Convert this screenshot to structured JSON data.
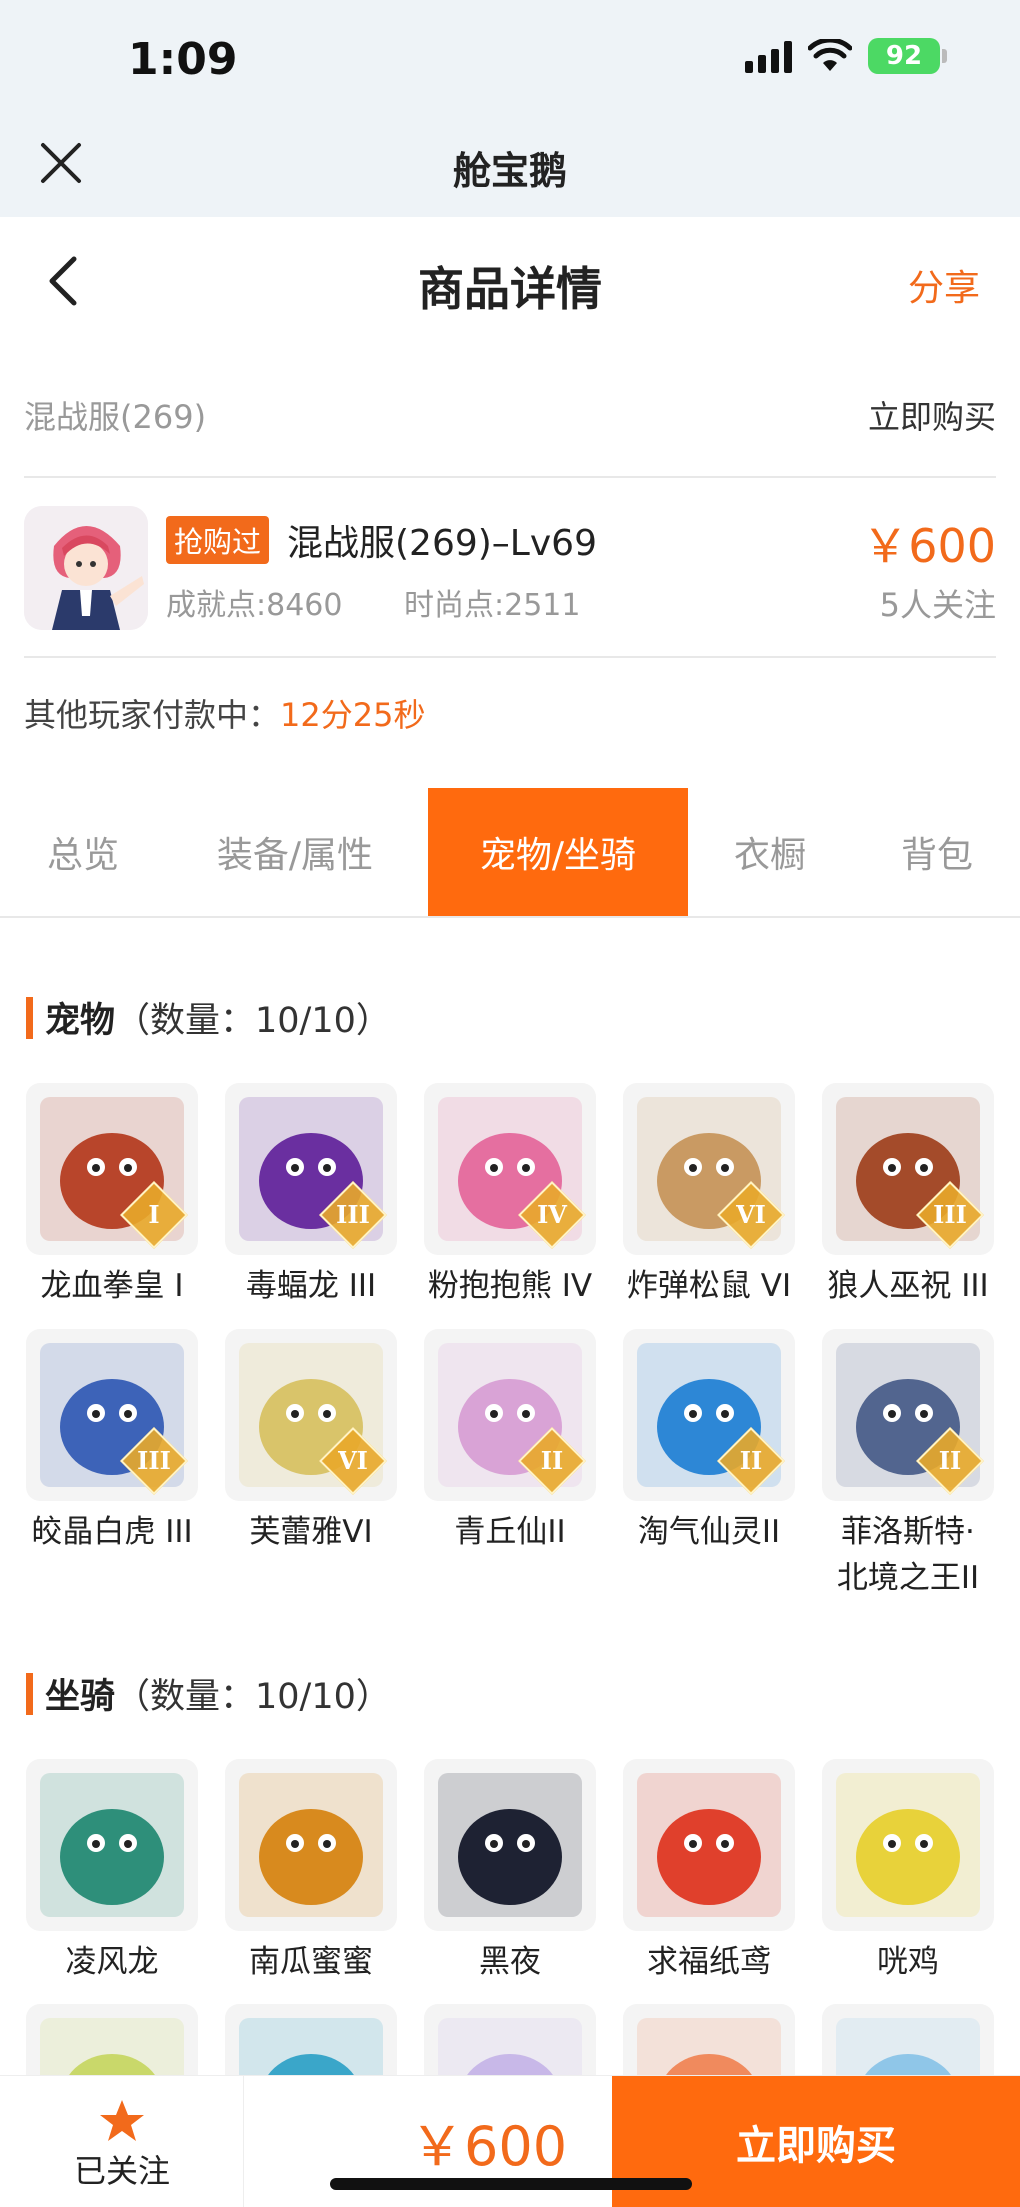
{
  "status_bar": {
    "time": "1:09",
    "battery": "92"
  },
  "app": {
    "title": "舱宝鹅"
  },
  "header": {
    "title": "商品详情",
    "share": "分享"
  },
  "server": {
    "name": "混战服(269)",
    "buy_now": "立即购买"
  },
  "product": {
    "tag": "抢购过",
    "name": "混战服(269)–Lv69",
    "achievement": "成就点:8460",
    "fashion": "时尚点:2511",
    "price": "￥600",
    "followers": "5人关注"
  },
  "paying": {
    "label": "其他玩家付款中：",
    "countdown": "12分25秒"
  },
  "tabs": [
    "总览",
    "装备/属性",
    "宠物/坐骑",
    "衣橱",
    "背包"
  ],
  "active_tab": "宠物/坐骑",
  "pets": {
    "title": "宠物",
    "count": "（数量：10/10）",
    "items": [
      {
        "name": "龙血拳皇 I",
        "rank": "I",
        "icon": "demon-icon",
        "color": "#b8452b"
      },
      {
        "name": "毒蝠龙 III",
        "rank": "III",
        "icon": "bat-dragon-icon",
        "color": "#6a2fa0"
      },
      {
        "name": "粉抱抱熊 IV",
        "rank": "IV",
        "icon": "bear-icon",
        "color": "#e56fa0"
      },
      {
        "name": "炸弹松鼠 VI",
        "rank": "VI",
        "icon": "squirrel-icon",
        "color": "#c99a63"
      },
      {
        "name": "狼人巫祝 III",
        "rank": "III",
        "icon": "werewolf-icon",
        "color": "#a44b2a"
      },
      {
        "name": "皎晶白虎 III",
        "rank": "III",
        "icon": "white-tiger-icon",
        "color": "#3d63b8"
      },
      {
        "name": "芙蕾雅VI",
        "rank": "VI",
        "icon": "fairy-icon",
        "color": "#d9c46a"
      },
      {
        "name": "青丘仙II",
        "rank": "II",
        "icon": "fox-spirit-icon",
        "color": "#d9a3d6"
      },
      {
        "name": "淘气仙灵II",
        "rank": "II",
        "icon": "blue-puppy-icon",
        "color": "#2d87d6"
      },
      {
        "name": "菲洛斯特·北境之王II",
        "rank": "II",
        "icon": "ice-king-icon",
        "color": "#52658f"
      }
    ]
  },
  "mounts": {
    "title": "坐骑",
    "count": "（数量：10/10）",
    "items": [
      {
        "name": "凌风龙",
        "icon": "green-dragon-icon",
        "color": "#2e8f7a"
      },
      {
        "name": "南瓜蜜蜜",
        "icon": "bee-icon",
        "color": "#d88a1e"
      },
      {
        "name": "黑夜",
        "icon": "black-dragon-icon",
        "color": "#1e2233"
      },
      {
        "name": "求福纸鸢",
        "icon": "goldfish-kite-icon",
        "color": "#e0402c"
      },
      {
        "name": "咣鸡",
        "icon": "yellow-chicken-icon",
        "color": "#e8d23a"
      }
    ]
  },
  "bottom": {
    "follow": "已关注",
    "price": "￥600",
    "buy": "立即购买"
  },
  "colors": {
    "accent": "#ff6a0e",
    "brand_text": "#f26a1b"
  }
}
